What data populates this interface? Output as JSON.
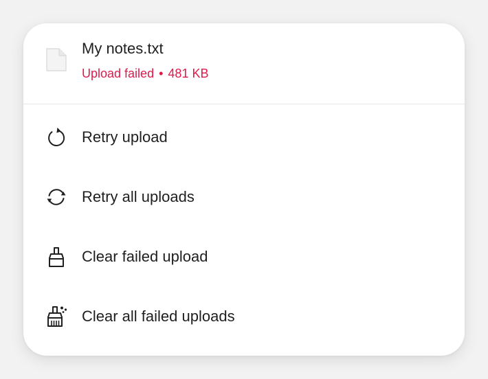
{
  "file": {
    "name": "My notes.txt",
    "status": "Upload failed",
    "separator": "•",
    "size": "481 KB",
    "icon": "document-icon",
    "status_color": "#e0194a"
  },
  "menu": {
    "items": [
      {
        "id": "retry-upload",
        "label": "Retry upload",
        "icon": "retry-icon"
      },
      {
        "id": "retry-all-uploads",
        "label": "Retry all uploads",
        "icon": "sync-icon"
      },
      {
        "id": "clear-failed-upload",
        "label": "Clear failed upload",
        "icon": "brush-icon"
      },
      {
        "id": "clear-all-failed-uploads",
        "label": "Clear all failed uploads",
        "icon": "broom-sparkle-icon"
      }
    ]
  }
}
